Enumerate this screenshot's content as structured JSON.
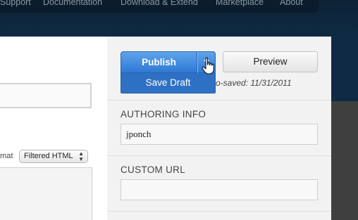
{
  "nav": {
    "items": [
      "Support",
      "Documentation",
      "Download & Extend",
      "Marketplace",
      "About"
    ]
  },
  "editor": {
    "format_label": "mat",
    "format_value": "Filtered HTML"
  },
  "publish": {
    "publish_label": "Publish",
    "save_draft_label": "Save Draft",
    "preview_label": "Preview",
    "autosave_text": "o-saved: 11/31/2011"
  },
  "authoring": {
    "label": "AUTHORING INFO",
    "value": "jponch"
  },
  "custom_url": {
    "label": "CUSTOM URL",
    "value": ""
  },
  "colors": {
    "publish_blue": "#3d86dc",
    "save_draft_blue": "#2e71c4",
    "sidebar_bg": "#f2f2f2",
    "header_navy": "#0f2a44"
  }
}
